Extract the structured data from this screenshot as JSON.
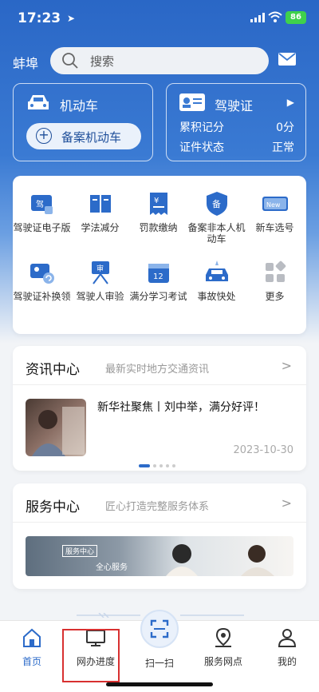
{
  "status_bar": {
    "time": "17:23",
    "battery": "86"
  },
  "header": {
    "city": "蚌埠",
    "search_placeholder": "搜索"
  },
  "vehicle_card": {
    "title": "机动车",
    "register_button": "备案机动车"
  },
  "license_card": {
    "title": "驾驶证",
    "points_label": "累积记分",
    "points_value": "0分",
    "status_label": "证件状态",
    "status_value": "正常"
  },
  "services": [
    {
      "label": "驾驶证电子版",
      "icon": "e-license-icon"
    },
    {
      "label": "学法减分",
      "icon": "book-icon"
    },
    {
      "label": "罚款缴纳",
      "icon": "receipt-icon"
    },
    {
      "label": "备案非本人机动车",
      "icon": "shield-icon"
    },
    {
      "label": "新车选号",
      "icon": "new-plate-icon"
    },
    {
      "label": "驾驶证补换领",
      "icon": "license-renew-icon"
    },
    {
      "label": "驾驶人审验",
      "icon": "review-board-icon"
    },
    {
      "label": "满分学习考试",
      "icon": "exam-calendar-icon"
    },
    {
      "label": "事故快处",
      "icon": "accident-icon"
    },
    {
      "label": "更多",
      "icon": "more-grid-icon"
    }
  ],
  "news_panel": {
    "title": "资讯中心",
    "subtitle": "最新实时地方交通资讯",
    "headline": "新华社聚焦丨刘中举，满分好评！",
    "date": "2023-10-30"
  },
  "service_panel": {
    "title": "服务中心",
    "subtitle": "匠心打造完整服务体系",
    "banner_tag": "服务中心",
    "banner_text": "全心服务"
  },
  "tabbar": [
    {
      "label": "首页",
      "icon": "home-icon"
    },
    {
      "label": "网办进度",
      "icon": "monitor-icon"
    },
    {
      "label": "扫一扫",
      "icon": "scan-icon"
    },
    {
      "label": "服务网点",
      "icon": "map-pin-icon"
    },
    {
      "label": "我的",
      "icon": "user-icon"
    }
  ],
  "colors": {
    "primary": "#2c6bc9",
    "highlight": "#d83030"
  }
}
